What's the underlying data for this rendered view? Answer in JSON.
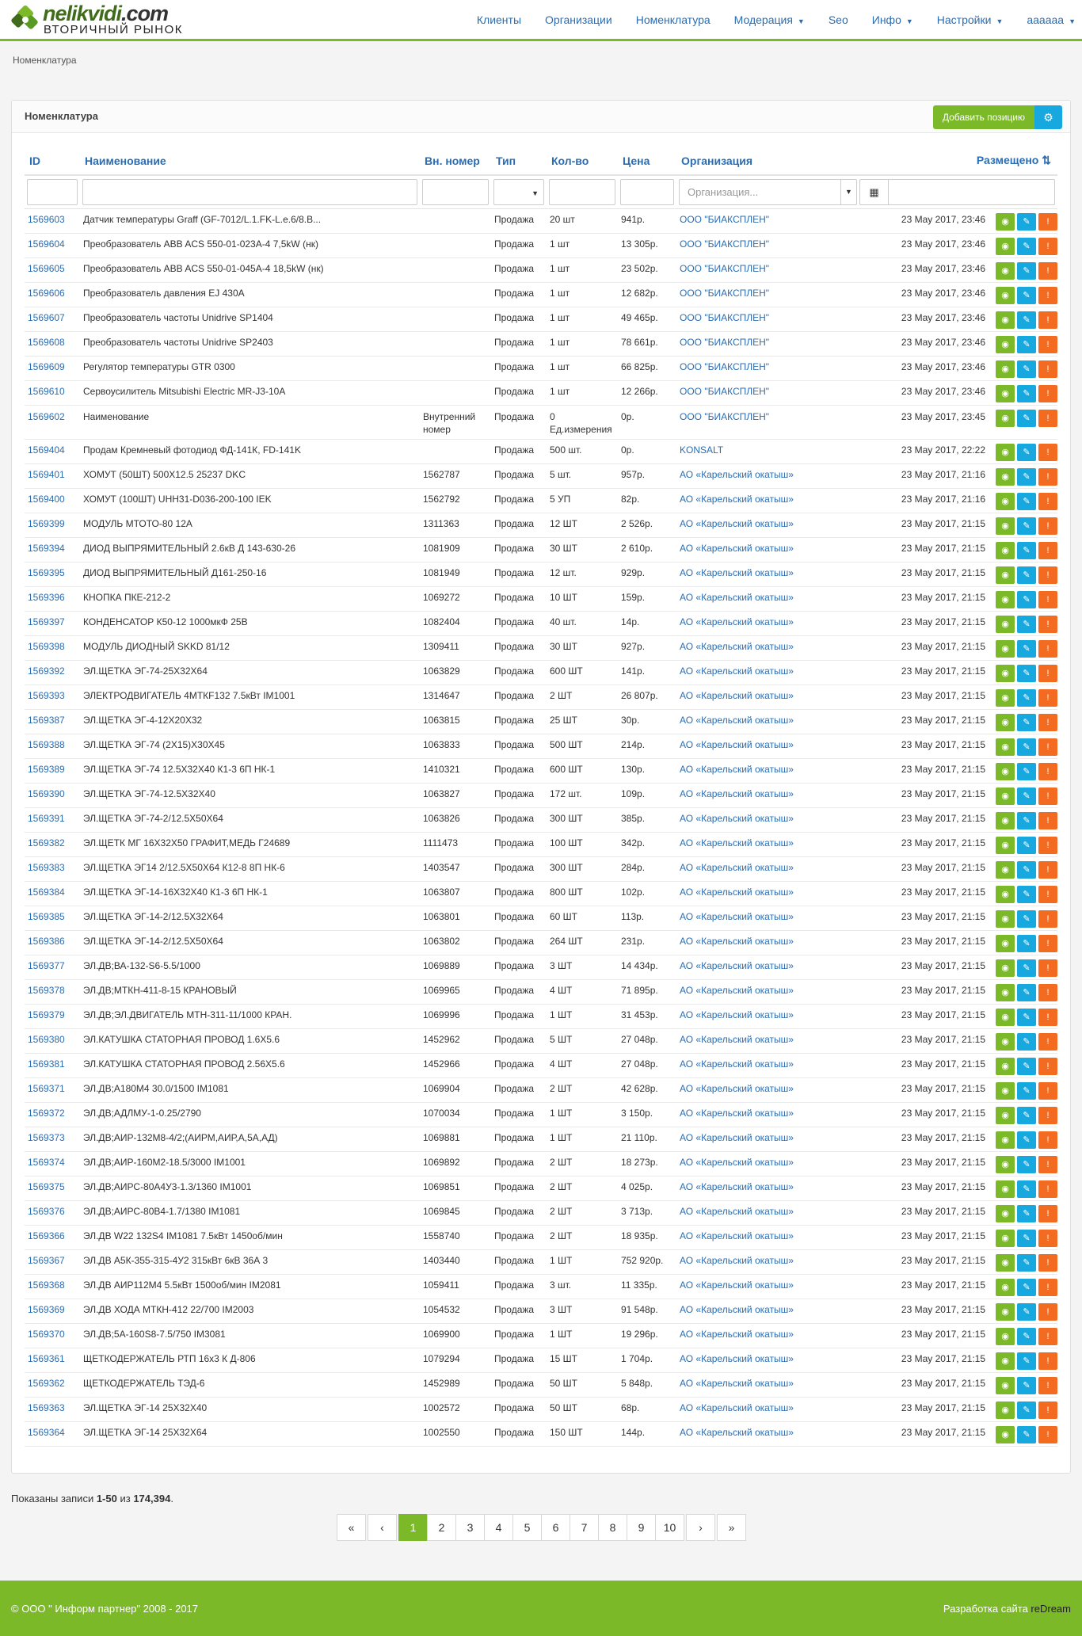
{
  "brand": {
    "name_left": "nelikvidi",
    "name_right": ".com",
    "tagline": "ВТОРИЧНЫЙ РЫНОК"
  },
  "nav": {
    "items": [
      "Клиенты",
      "Организации",
      "Номенклатура",
      "Модерация",
      "Seo",
      "Инфо",
      "Настройки",
      "aaaaaa"
    ],
    "dropdown": [
      false,
      false,
      false,
      true,
      false,
      true,
      true,
      true
    ]
  },
  "breadcrumb": "Номенклатура",
  "panel": {
    "title": "Номенклатура",
    "add_button": "Добавить позицию"
  },
  "table": {
    "columns": [
      "ID",
      "Наименование",
      "Вн. номер",
      "Тип",
      "Кол-во",
      "Цена",
      "Организация",
      "Размещено"
    ],
    "org_placeholder": "Организация...",
    "rows": [
      [
        "1569603",
        "Датчик температуры Graff (GF-7012/L.1.FK-L.e.6/8.B...",
        "",
        "Продажа",
        "20 шт",
        "941р.",
        "ООО \"БИАКСПЛЕН\"",
        "23 May 2017, 23:46"
      ],
      [
        "1569604",
        "Преобразователь ABB ACS 550-01-023A-4 7,5kW (нк)",
        "",
        "Продажа",
        "1 шт",
        "13 305р.",
        "ООО \"БИАКСПЛЕН\"",
        "23 May 2017, 23:46"
      ],
      [
        "1569605",
        "Преобразователь ABB ACS 550-01-045A-4 18,5kW (нк)",
        "",
        "Продажа",
        "1 шт",
        "23 502р.",
        "ООО \"БИАКСПЛЕН\"",
        "23 May 2017, 23:46"
      ],
      [
        "1569606",
        "Преобразователь давления EJ 430A",
        "",
        "Продажа",
        "1 шт",
        "12 682р.",
        "ООО \"БИАКСПЛЕН\"",
        "23 May 2017, 23:46"
      ],
      [
        "1569607",
        "Преобразователь частоты Unidrive SP1404",
        "",
        "Продажа",
        "1 шт",
        "49 465р.",
        "ООО \"БИАКСПЛЕН\"",
        "23 May 2017, 23:46"
      ],
      [
        "1569608",
        "Преобразователь частоты Unidrive SP2403",
        "",
        "Продажа",
        "1 шт",
        "78 661р.",
        "ООО \"БИАКСПЛЕН\"",
        "23 May 2017, 23:46"
      ],
      [
        "1569609",
        "Регулятор температуры GTR 0300",
        "",
        "Продажа",
        "1 шт",
        "66 825р.",
        "ООО \"БИАКСПЛЕН\"",
        "23 May 2017, 23:46"
      ],
      [
        "1569610",
        "Сервоусилитель Mitsubishi Electric MR-J3-10A",
        "",
        "Продажа",
        "1 шт",
        "12 266р.",
        "ООО \"БИАКСПЛЕН\"",
        "23 May 2017, 23:46"
      ],
      [
        "1569602",
        "Наименование",
        "Внутренний номер",
        "Продажа",
        "0 Ед.измерения",
        "0р.",
        "ООО \"БИАКСПЛЕН\"",
        "23 May 2017, 23:45"
      ],
      [
        "1569404",
        "Продам Кремневый фотодиод ФД-141К, FD-141K",
        "",
        "Продажа",
        "500 шт.",
        "0р.",
        "KONSALT",
        "23 May 2017, 22:22"
      ],
      [
        "1569401",
        "ХОМУТ (50ШТ) 500X12.5 25237 DKC",
        "1562787",
        "Продажа",
        "5 шт.",
        "957р.",
        "АО «Карельский окатыш»",
        "23 May 2017, 21:16"
      ],
      [
        "1569400",
        "ХОМУТ (100ШТ) UHH31-D036-200-100 IEK",
        "1562792",
        "Продажа",
        "5 УП",
        "82р.",
        "АО «Карельский окатыш»",
        "23 May 2017, 21:16"
      ],
      [
        "1569399",
        "МОДУЛЬ МТОТО-80 12А",
        "1311363",
        "Продажа",
        "12 ШТ",
        "2 526р.",
        "АО «Карельский окатыш»",
        "23 May 2017, 21:15"
      ],
      [
        "1569394",
        "ДИОД ВЫПРЯМИТЕЛЬНЫЙ 2.6кВ Д 143-630-26",
        "1081909",
        "Продажа",
        "30 ШТ",
        "2 610р.",
        "АО «Карельский окатыш»",
        "23 May 2017, 21:15"
      ],
      [
        "1569395",
        "ДИОД ВЫПРЯМИТЕЛЬНЫЙ Д161-250-16",
        "1081949",
        "Продажа",
        "12 шт.",
        "929р.",
        "АО «Карельский окатыш»",
        "23 May 2017, 21:15"
      ],
      [
        "1569396",
        "КНОПКА ПКЕ-212-2",
        "1069272",
        "Продажа",
        "10 ШТ",
        "159р.",
        "АО «Карельский окатыш»",
        "23 May 2017, 21:15"
      ],
      [
        "1569397",
        "КОНДЕНСАТОР К50-12 1000мкФ 25В",
        "1082404",
        "Продажа",
        "40 шт.",
        "14р.",
        "АО «Карельский окатыш»",
        "23 May 2017, 21:15"
      ],
      [
        "1569398",
        "МОДУЛЬ ДИОДНЫЙ SKKD 81/12",
        "1309411",
        "Продажа",
        "30 ШТ",
        "927р.",
        "АО «Карельский окатыш»",
        "23 May 2017, 21:15"
      ],
      [
        "1569392",
        "ЭЛ.ЩЕТКА ЭГ-74-25Х32Х64",
        "1063829",
        "Продажа",
        "600 ШТ",
        "141р.",
        "АО «Карельский окатыш»",
        "23 May 2017, 21:15"
      ],
      [
        "1569393",
        "ЭЛЕКТРОДВИГАТЕЛЬ 4МТКF132 7.5кВт IM1001",
        "1314647",
        "Продажа",
        "2 ШТ",
        "26 807р.",
        "АО «Карельский окатыш»",
        "23 May 2017, 21:15"
      ],
      [
        "1569387",
        "ЭЛ.ЩЕТКА ЭГ-4-12Х20Х32",
        "1063815",
        "Продажа",
        "25 ШТ",
        "30р.",
        "АО «Карельский окатыш»",
        "23 May 2017, 21:15"
      ],
      [
        "1569388",
        "ЭЛ.ЩЕТКА ЭГ-74 (2Х15)Х30Х45",
        "1063833",
        "Продажа",
        "500 ШТ",
        "214р.",
        "АО «Карельский окатыш»",
        "23 May 2017, 21:15"
      ],
      [
        "1569389",
        "ЭЛ.ЩЕТКА ЭГ-74 12.5Х32Х40 К1-3 6П НК-1",
        "1410321",
        "Продажа",
        "600 ШТ",
        "130р.",
        "АО «Карельский окатыш»",
        "23 May 2017, 21:15"
      ],
      [
        "1569390",
        "ЭЛ.ЩЕТКА ЭГ-74-12.5Х32Х40",
        "1063827",
        "Продажа",
        "172 шт.",
        "109р.",
        "АО «Карельский окатыш»",
        "23 May 2017, 21:15"
      ],
      [
        "1569391",
        "ЭЛ.ЩЕТКА ЭГ-74-2/12.5Х50Х64",
        "1063826",
        "Продажа",
        "300 ШТ",
        "385р.",
        "АО «Карельский окатыш»",
        "23 May 2017, 21:15"
      ],
      [
        "1569382",
        "ЭЛ.ЩЕТК МГ 16Х32Х50 ГРАФИТ,МЕДЬ Г24689",
        "1111473",
        "Продажа",
        "100 ШТ",
        "342р.",
        "АО «Карельский окатыш»",
        "23 May 2017, 21:15"
      ],
      [
        "1569383",
        "ЭЛ.ЩЕТКА ЭГ14 2/12.5Х50Х64 К12-8 8П НК-6",
        "1403547",
        "Продажа",
        "300 ШТ",
        "284р.",
        "АО «Карельский окатыш»",
        "23 May 2017, 21:15"
      ],
      [
        "1569384",
        "ЭЛ.ЩЕТКА ЭГ-14-16Х32Х40 К1-3 6П НК-1",
        "1063807",
        "Продажа",
        "800 ШТ",
        "102р.",
        "АО «Карельский окатыш»",
        "23 May 2017, 21:15"
      ],
      [
        "1569385",
        "ЭЛ.ЩЕТКА ЭГ-14-2/12.5Х32Х64",
        "1063801",
        "Продажа",
        "60 ШТ",
        "113р.",
        "АО «Карельский окатыш»",
        "23 May 2017, 21:15"
      ],
      [
        "1569386",
        "ЭЛ.ЩЕТКА ЭГ-14-2/12.5Х50Х64",
        "1063802",
        "Продажа",
        "264 ШТ",
        "231р.",
        "АО «Карельский окатыш»",
        "23 May 2017, 21:15"
      ],
      [
        "1569377",
        "ЭЛ.ДВ;ВА-132-S6-5.5/1000",
        "1069889",
        "Продажа",
        "3 ШТ",
        "14 434р.",
        "АО «Карельский окатыш»",
        "23 May 2017, 21:15"
      ],
      [
        "1569378",
        "ЭЛ.ДВ;МТКН-411-8-15 КРАНОВЫЙ",
        "1069965",
        "Продажа",
        "4 ШТ",
        "71 895р.",
        "АО «Карельский окатыш»",
        "23 May 2017, 21:15"
      ],
      [
        "1569379",
        "ЭЛ.ДВ;ЭЛ.ДВИГАТЕЛЬ МТН-311-11/1000 КРАН.",
        "1069996",
        "Продажа",
        "1 ШТ",
        "31 453р.",
        "АО «Карельский окатыш»",
        "23 May 2017, 21:15"
      ],
      [
        "1569380",
        "ЭЛ.КАТУШКА СТАТОРНАЯ ПРОВОД 1.6Х5.6",
        "1452962",
        "Продажа",
        "5 ШТ",
        "27 048р.",
        "АО «Карельский окатыш»",
        "23 May 2017, 21:15"
      ],
      [
        "1569381",
        "ЭЛ.КАТУШКА СТАТОРНАЯ ПРОВОД 2.56Х5.6",
        "1452966",
        "Продажа",
        "4 ШТ",
        "27 048р.",
        "АО «Карельский окатыш»",
        "23 May 2017, 21:15"
      ],
      [
        "1569371",
        "ЭЛ.ДВ;А180М4 30.0/1500 IM1081",
        "1069904",
        "Продажа",
        "2 ШТ",
        "42 628р.",
        "АО «Карельский окатыш»",
        "23 May 2017, 21:15"
      ],
      [
        "1569372",
        "ЭЛ.ДВ;АДЛМУ-1-0.25/2790",
        "1070034",
        "Продажа",
        "1 ШТ",
        "3 150р.",
        "АО «Карельский окатыш»",
        "23 May 2017, 21:15"
      ],
      [
        "1569373",
        "ЭЛ.ДВ;АИР-132М8-4/2;(АИРМ,АИР,А,5А,АД)",
        "1069881",
        "Продажа",
        "1 ШТ",
        "21 110р.",
        "АО «Карельский окатыш»",
        "23 May 2017, 21:15"
      ],
      [
        "1569374",
        "ЭЛ.ДВ;АИР-160М2-18.5/3000 IM1001",
        "1069892",
        "Продажа",
        "2 ШТ",
        "18 273р.",
        "АО «Карельский окатыш»",
        "23 May 2017, 21:15"
      ],
      [
        "1569375",
        "ЭЛ.ДВ;АИРС-80А4У3-1.3/1360 IM1001",
        "1069851",
        "Продажа",
        "2 ШТ",
        "4 025р.",
        "АО «Карельский окатыш»",
        "23 May 2017, 21:15"
      ],
      [
        "1569376",
        "ЭЛ.ДВ;АИРС-80В4-1.7/1380 IM1081",
        "1069845",
        "Продажа",
        "2 ШТ",
        "3 713р.",
        "АО «Карельский окатыш»",
        "23 May 2017, 21:15"
      ],
      [
        "1569366",
        "ЭЛ.ДВ W22 132S4 IM1081 7.5кВт 1450об/мин",
        "1558740",
        "Продажа",
        "2 ШТ",
        "18 935р.",
        "АО «Карельский окатыш»",
        "23 May 2017, 21:15"
      ],
      [
        "1569367",
        "ЭЛ.ДВ А5К-355-315-4У2 315кВт 6кВ 36А 3",
        "1403440",
        "Продажа",
        "1 ШТ",
        "752 920р.",
        "АО «Карельский окатыш»",
        "23 May 2017, 21:15"
      ],
      [
        "1569368",
        "ЭЛ.ДВ АИР112М4 5.5кВт 1500об/мин IM2081",
        "1059411",
        "Продажа",
        "3 шт.",
        "11 335р.",
        "АО «Карельский окатыш»",
        "23 May 2017, 21:15"
      ],
      [
        "1569369",
        "ЭЛ.ДВ ХОДА МТКН-412 22/700 IM2003",
        "1054532",
        "Продажа",
        "3 ШТ",
        "91 548р.",
        "АО «Карельский окатыш»",
        "23 May 2017, 21:15"
      ],
      [
        "1569370",
        "ЭЛ.ДВ;5А-160S8-7.5/750 IM3081",
        "1069900",
        "Продажа",
        "1 ШТ",
        "19 296р.",
        "АО «Карельский окатыш»",
        "23 May 2017, 21:15"
      ],
      [
        "1569361",
        "ЩЕТКОДЕРЖАТЕЛЬ РТП 16х3 К Д-806",
        "1079294",
        "Продажа",
        "15 ШТ",
        "1 704р.",
        "АО «Карельский окатыш»",
        "23 May 2017, 21:15"
      ],
      [
        "1569362",
        "ЩЕТКОДЕРЖАТЕЛЬ ТЭД-6",
        "1452989",
        "Продажа",
        "50 ШТ",
        "5 848р.",
        "АО «Карельский окатыш»",
        "23 May 2017, 21:15"
      ],
      [
        "1569363",
        "ЭЛ.ЩЕТКА ЭГ-14 25Х32Х40",
        "1002572",
        "Продажа",
        "50 ШТ",
        "68р.",
        "АО «Карельский окатыш»",
        "23 May 2017, 21:15"
      ],
      [
        "1569364",
        "ЭЛ.ЩЕТКА ЭГ-14 25Х32Х64",
        "1002550",
        "Продажа",
        "150 ШТ",
        "144р.",
        "АО «Карельский окатыш»",
        "23 May 2017, 21:15"
      ]
    ]
  },
  "summary": {
    "prefix": "Показаны записи ",
    "range": "1-50",
    "middle": " из ",
    "total": "174,394",
    "suffix": "."
  },
  "pagination": {
    "first": "«",
    "prev": "‹",
    "pages": [
      "1",
      "2",
      "3",
      "4",
      "5",
      "6",
      "7",
      "8",
      "9",
      "10"
    ],
    "current": "1",
    "next": "›",
    "last": "»"
  },
  "footer": {
    "left": "© ООО \" Информ партнер\" 2008 - 2017",
    "right_prefix": "Разработка сайта ",
    "right_brand": "reDream"
  },
  "icons": {
    "view": "eye-icon",
    "edit": "pencil-icon",
    "report": "exclamation-icon",
    "settings": "gear-icon",
    "calendar": "calendar-icon",
    "sort": "sort-icon"
  },
  "colors": {
    "green": "#7bb928",
    "blue": "#18a8e0",
    "orange": "#f36b21",
    "link": "#2a6db3"
  }
}
